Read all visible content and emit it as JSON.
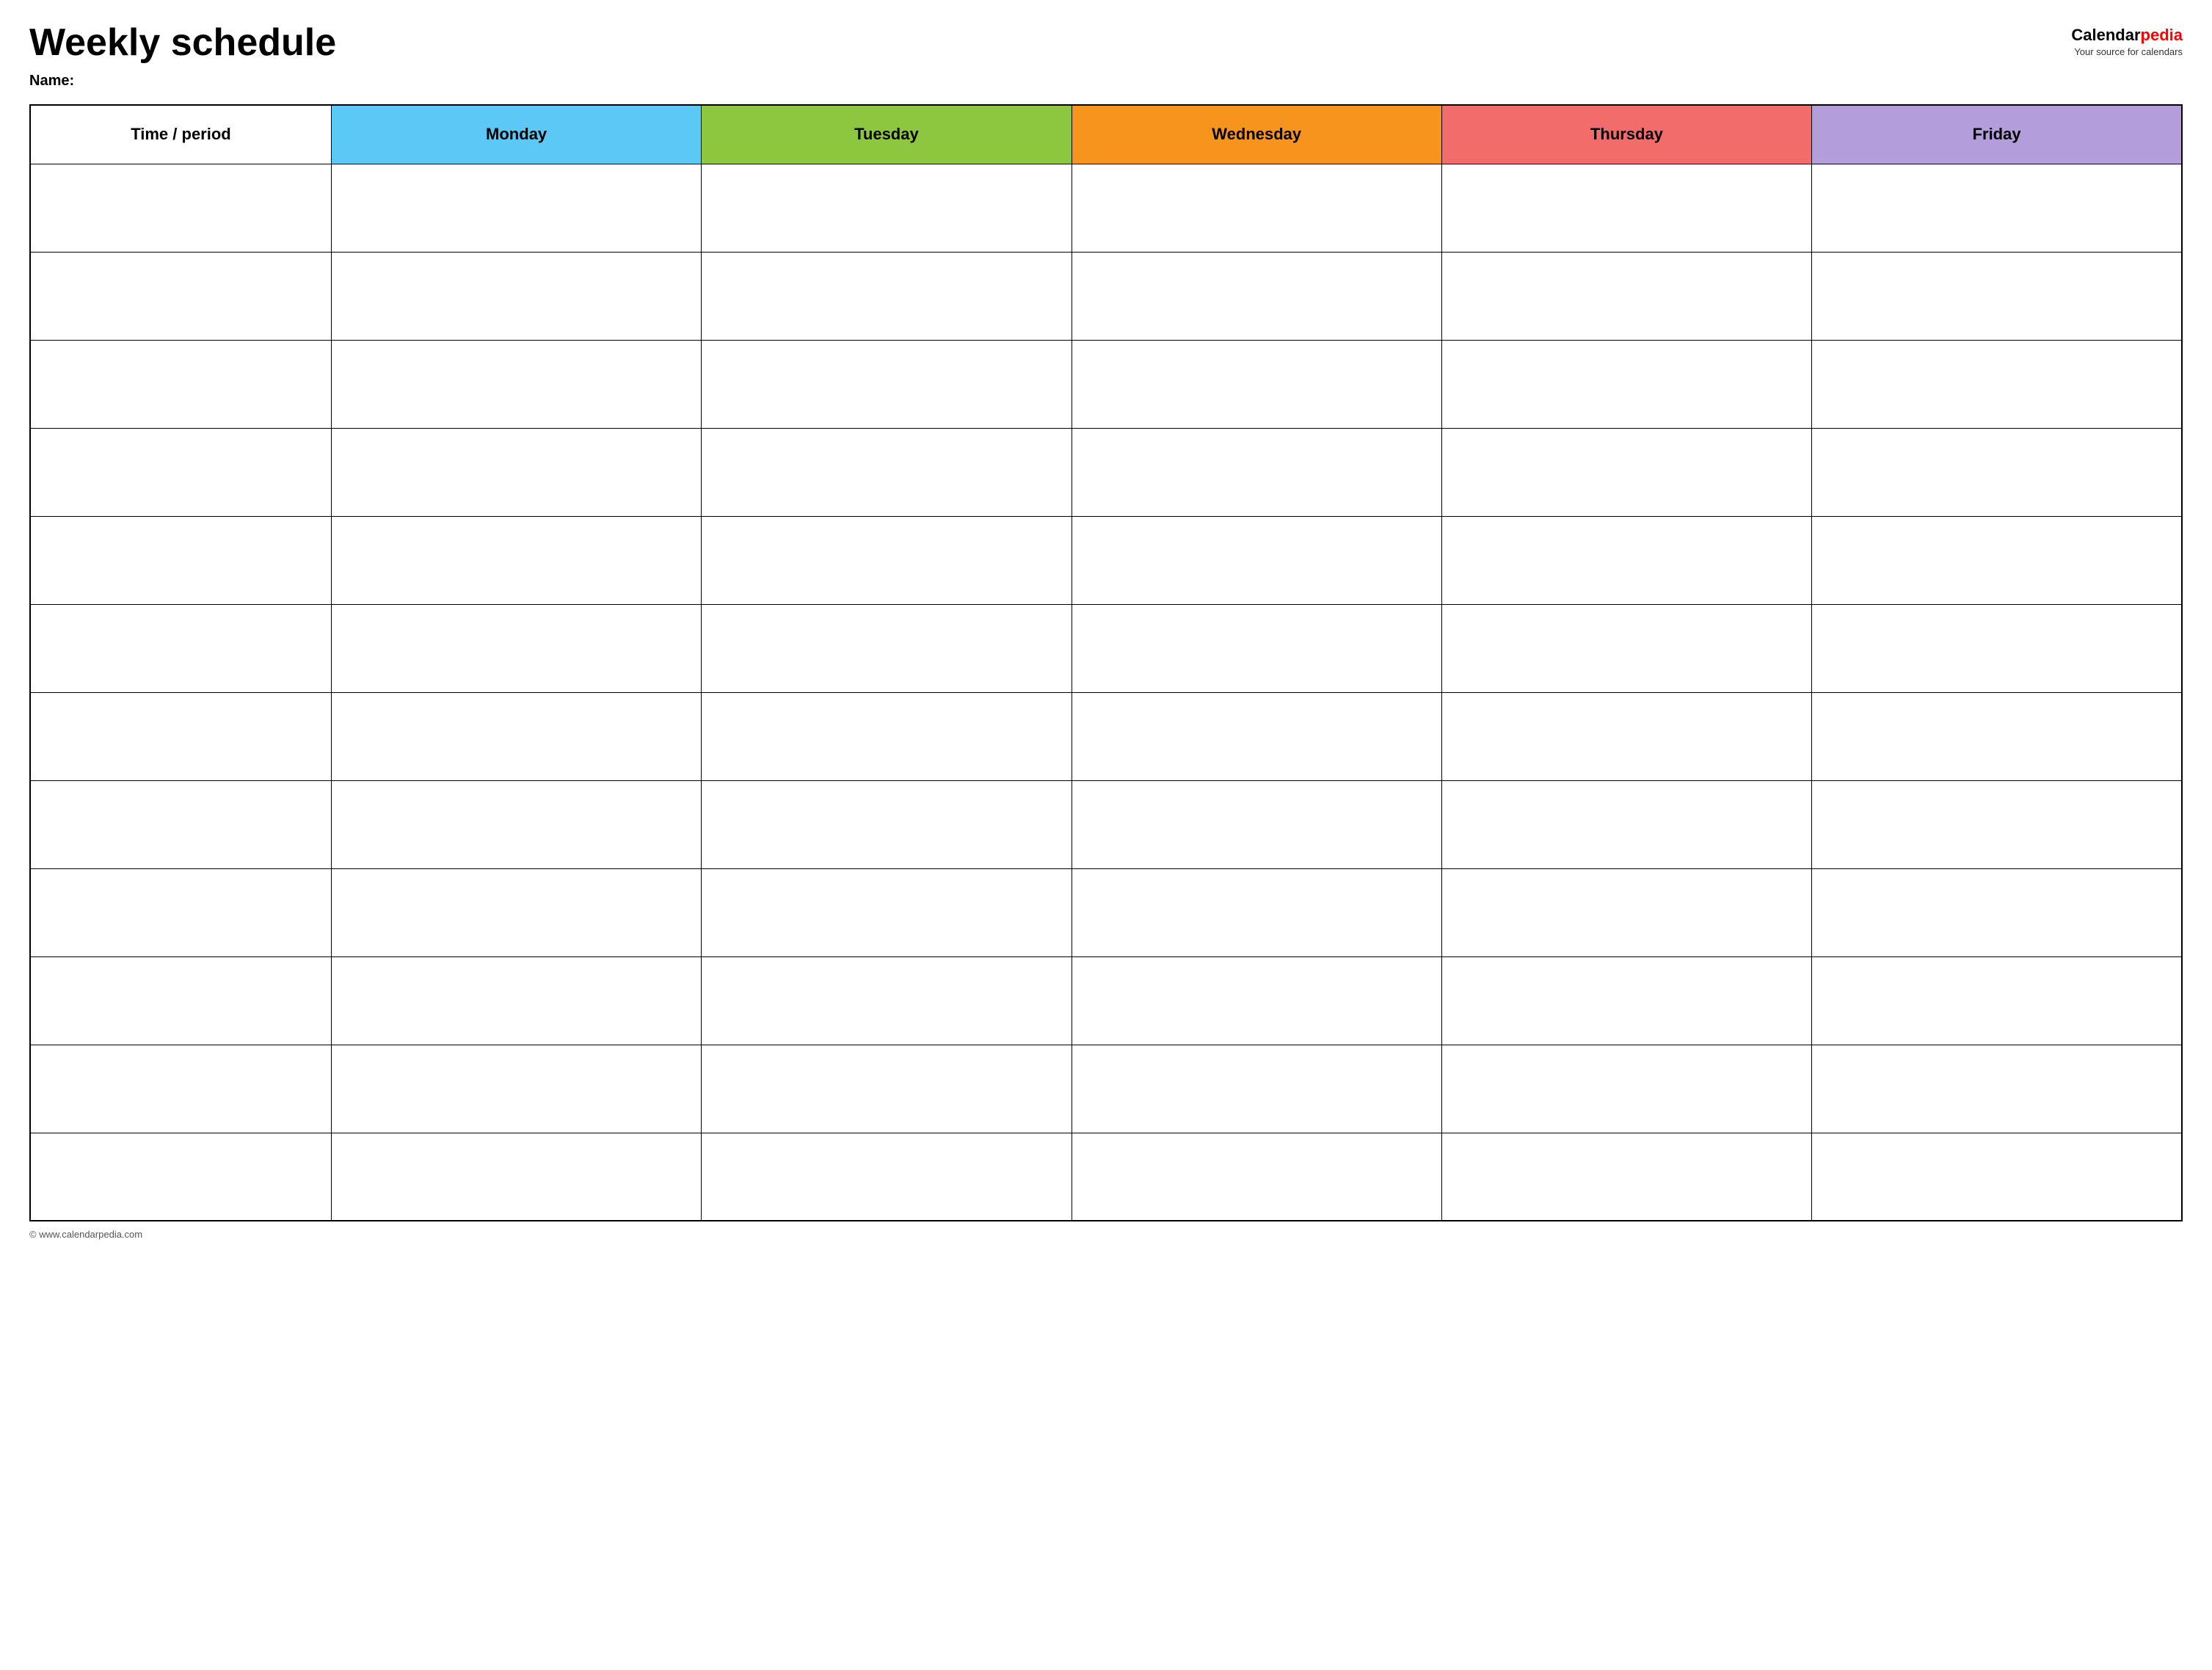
{
  "header": {
    "title": "Weekly schedule",
    "name_label": "Name:",
    "logo_brand": "Calendar",
    "logo_accent": "pedia",
    "logo_tagline": "Your source for calendars"
  },
  "table": {
    "columns": [
      {
        "id": "time",
        "label": "Time / period",
        "color": "#ffffff",
        "class": "col-time"
      },
      {
        "id": "monday",
        "label": "Monday",
        "color": "#5bc8f5",
        "class": "col-monday"
      },
      {
        "id": "tuesday",
        "label": "Tuesday",
        "color": "#8dc63f",
        "class": "col-tuesday"
      },
      {
        "id": "wednesday",
        "label": "Wednesday",
        "color": "#f7941d",
        "class": "col-wednesday"
      },
      {
        "id": "thursday",
        "label": "Thursday",
        "color": "#f26c6c",
        "class": "col-thursday"
      },
      {
        "id": "friday",
        "label": "Friday",
        "color": "#b39ddb",
        "class": "col-friday"
      }
    ],
    "row_count": 12
  },
  "footer": {
    "text": "© www.calendarpedia.com"
  }
}
